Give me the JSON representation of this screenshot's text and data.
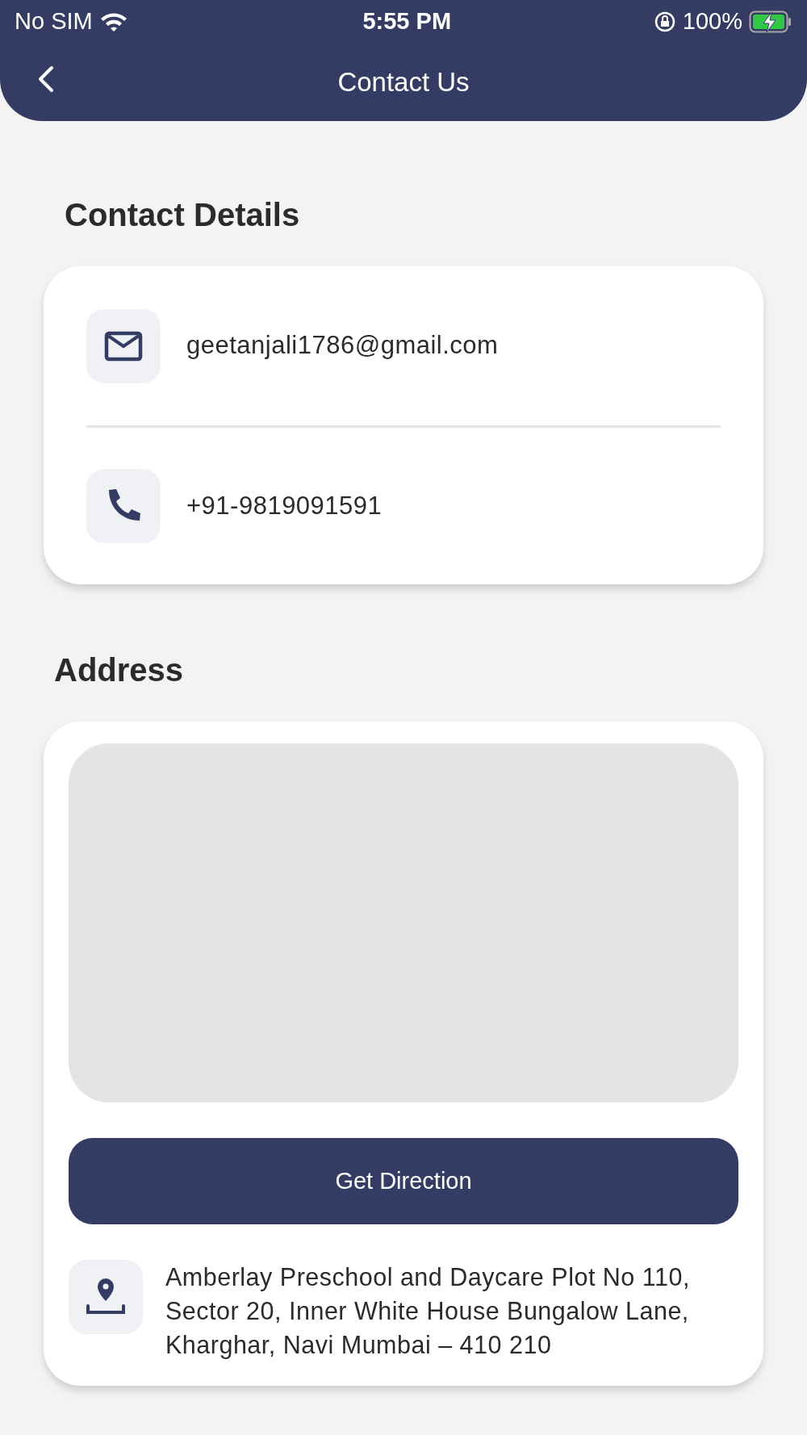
{
  "status_bar": {
    "carrier": "No SIM",
    "time": "5:55 PM",
    "battery": "100%"
  },
  "header": {
    "title": "Contact Us"
  },
  "contact_section": {
    "title": "Contact Details",
    "items": [
      {
        "kind": "email",
        "text": "geetanjali1786@gmail.com"
      },
      {
        "kind": "phone",
        "text": "+91-9819091591"
      }
    ]
  },
  "address_section": {
    "title": "Address",
    "button": "Get Direction",
    "address": "Amberlay Preschool and Daycare Plot No 110, Sector 20, Inner White House Bungalow Lane, Kharghar, Navi Mumbai – 410 210"
  }
}
